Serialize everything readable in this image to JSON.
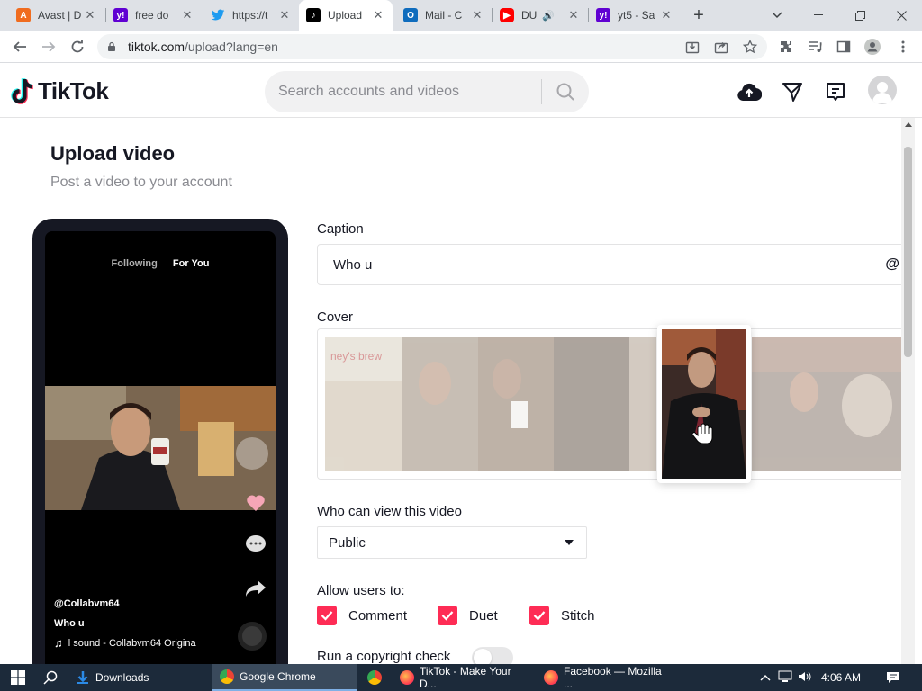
{
  "browser": {
    "tabs": [
      {
        "title": "Avast | D",
        "favicon": "avast-icon",
        "color": "#f06c1f"
      },
      {
        "title": "free do",
        "favicon": "yahoo-icon",
        "color": "#6001d2"
      },
      {
        "title": "https://t",
        "favicon": "twitter-icon",
        "color": "#1d9bf0"
      },
      {
        "title": "Upload",
        "favicon": "tiktok-icon",
        "color": "#000000",
        "active": true
      },
      {
        "title": "Mail - C",
        "favicon": "outlook-icon",
        "color": "#0f6cbd"
      },
      {
        "title": "DU",
        "favicon": "youtube-icon",
        "color": "#ff0000"
      },
      {
        "title": "yt5 - Sa",
        "favicon": "yahoo-icon",
        "color": "#6001d2"
      }
    ],
    "url_host": "tiktok.com",
    "url_path": "/upload?lang=en"
  },
  "header": {
    "logo": "TikTok",
    "search_placeholder": "Search accounts and videos"
  },
  "page": {
    "title": "Upload video",
    "subtitle": "Post a video to your account"
  },
  "preview": {
    "tab_following": "Following",
    "tab_for_you": "For You",
    "username": "@Collabvm64",
    "caption": "Who u",
    "sound": "l sound - Collabvm64 Origina"
  },
  "form": {
    "caption_label": "Caption",
    "caption_value": "Who u",
    "mention_symbol": "@",
    "cover_label": "Cover",
    "visibility_label": "Who can view this video",
    "visibility_value": "Public",
    "allow_label": "Allow users to:",
    "allow_options": [
      {
        "label": "Comment",
        "checked": true
      },
      {
        "label": "Duet",
        "checked": true
      },
      {
        "label": "Stitch",
        "checked": true
      }
    ],
    "copyright_label": "Run a copyright check",
    "copyright_on": false
  },
  "taskbar": {
    "items": [
      "Downloads",
      "Google Chrome",
      "",
      "TikTok - Make Your D...",
      "Facebook — Mozilla ..."
    ],
    "time": "4:06 AM"
  },
  "colors": {
    "accent": "#fe2c55",
    "taskbar": "#1c2a3a"
  }
}
